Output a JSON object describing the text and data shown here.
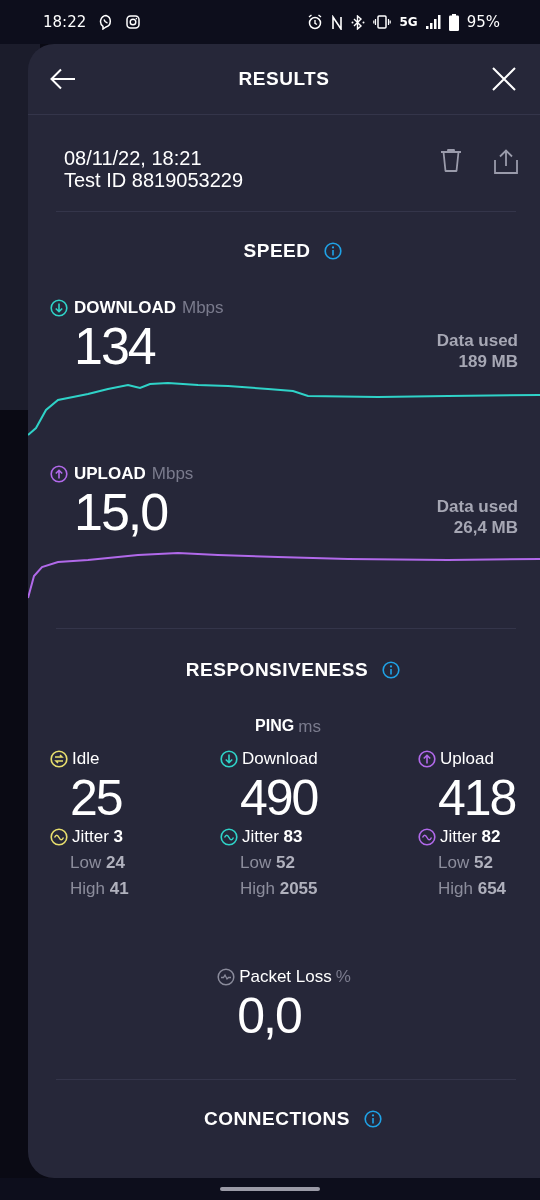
{
  "status_bar": {
    "time": "18:22",
    "network": "5G",
    "battery": "95%"
  },
  "header": {
    "title": "RESULTS"
  },
  "test": {
    "date": "08/11/22, 18:21",
    "test_id": "Test ID 8819053229"
  },
  "speed": {
    "title": "SPEED",
    "metrics": [
      {
        "kind": "download",
        "label": "DOWNLOAD",
        "unit": "Mbps",
        "value": "134",
        "data_used_label": "Data used",
        "data_used": "189 MB",
        "color": "#2fd3c8"
      },
      {
        "kind": "upload",
        "label": "UPLOAD",
        "unit": "Mbps",
        "value": "15,0",
        "data_used_label": "Data used",
        "data_used": "26,4 MB",
        "color": "#b169ea"
      }
    ]
  },
  "responsiveness": {
    "title": "RESPONSIVENESS",
    "ping_label": "PING",
    "ping_unit": "ms",
    "columns": [
      {
        "kind": "idle",
        "label": "Idle",
        "value": "25",
        "jitter": "Jitter **3**",
        "low": "Low **24**",
        "high": "High **41**",
        "color": "#e8df6e"
      },
      {
        "kind": "download",
        "label": "Download",
        "value": "490",
        "jitter": "Jitter **83**",
        "low": "Low **52**",
        "high": "High **2055**",
        "color": "#2fd3c8"
      },
      {
        "kind": "upload",
        "label": "Upload",
        "value": "418",
        "jitter": "Jitter **82**",
        "low": "Low **52**",
        "high": "High **654**",
        "color": "#b169ea"
      }
    ],
    "packet_loss": {
      "label": "Packet Loss",
      "unit": "%",
      "value": "0,0"
    }
  },
  "connections": {
    "title": "CONNECTIONS"
  }
}
